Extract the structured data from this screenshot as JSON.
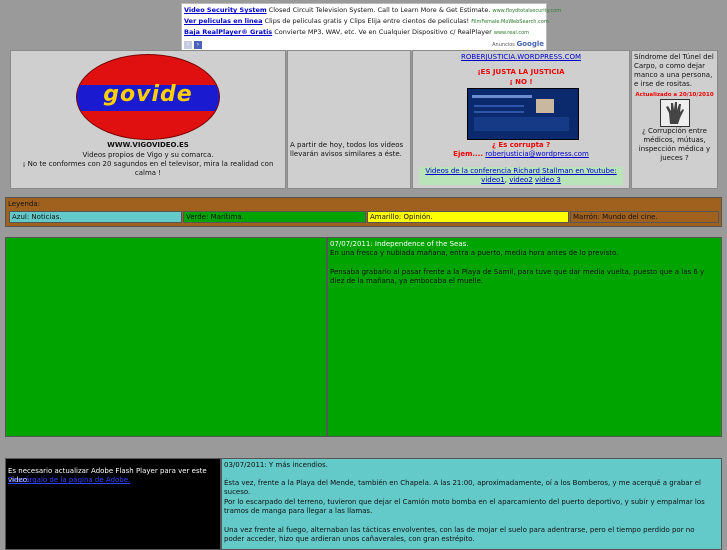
{
  "ads": {
    "rows": [
      {
        "title": "Video Security System",
        "text": "Closed Circuit Television System. Call to Learn More & Get Estimate.",
        "url": "www.floydtotalsecurity.com"
      },
      {
        "title": "Ver peliculas en linea",
        "text": "Clips de peliculas gratis y Clips Elija entre cientos de peliculas!",
        "url": "FilmFemale.MoWebSearch.com"
      },
      {
        "title": "Baja RealPlayer® Gratis",
        "text": "Convierte MP3, WAV, etc. Ve en Cualquier Dispositivo c/ RealPlayer",
        "url": "www.real.com"
      }
    ],
    "prev_icon": "‹",
    "next_icon": "›",
    "ads_by": "Anuncios",
    "google": "Google"
  },
  "logo": {
    "text": "govide",
    "site": "WWW.VIGOVIDEO.ES",
    "line1": "Videos propios de Vigo y su comarca.",
    "line2": "¡ No te conformes con 20 sagundos en el televisor, mira la realidad con calma !"
  },
  "notice": {
    "text": "A partir de hoy, todos los videos llevarán avisos similares a éste."
  },
  "justicia": {
    "link": "ROBERJUSTICIA.WORDPRESS.COM",
    "head1": "¡ES JUSTA LA JUSTICIA",
    "head2": "¡ NO !",
    "corrupta": "¿ Es corrupta ?",
    "ejem": "Ejem....",
    "ejem_link": "roberjusticia@wordpress.com",
    "conf_text": "Videos de la conferencia Richard Stallman en Youtube:",
    "video1": "video1",
    "video2": "video2",
    "video3": "video 3"
  },
  "carpo": {
    "text": "Síndrome del Túnel del Carpo, o como dejar manco a una persona, e irse de rositas.",
    "updated": "Actualizado a 20/10/2010",
    "question": "¿ Corrupción entre médicos, mútuas, inspección médica y jueces ?"
  },
  "legend": {
    "title": "Leyenda:",
    "items": [
      {
        "label": "Azul: Noticias.",
        "color": "#63c9c9"
      },
      {
        "label": "Verde: Marítima.",
        "color": "#00a400"
      },
      {
        "label": "Amarillo: Opinión.",
        "color": "#ffff00"
      },
      {
        "label": "Marrón: Mundo del cine.",
        "color": "#a0601e"
      }
    ]
  },
  "post1": {
    "title": "07/07/2011: Independence of the Seas.",
    "p1": "En una fresca y nublada mañana, entra a puerto, media hora antes de lo previsto.",
    "p2": "Pensaba grabarlo al pasar frente a la Playa de Samil, para tuve que dar media vuelta, puesto que a las 6 y diez de la mañana, ya embocaba el muelle."
  },
  "post2": {
    "flash": "Es necesario actualizar Adobe Flash Player para ver este video.",
    "flash_link": "Descárgalo de la página de Adobe.",
    "title": "03/07/2011: Y más incendios.",
    "p1": "Ésta vez, frente a la Playa del Mende, también en Chapela. A las 21:00, aproximadamente, oí a los Bomberos, y me acerqué a grabar el suceso.",
    "p2": "Por lo escarpado del terreno, tuvieron que dejar el Camión moto bomba en el aparcamiento del puerto deportivo, y subir y empalmar los tramos de manga para llegar a las llamas.",
    "p3": "Una vez frente al fuego, alternaban las tácticas envolventes, con las de mojar el suelo para adentrarse, pero el tiempo perdido por no poder acceder, hizo que ardieran unos cañaverales, con gran estrépito."
  }
}
